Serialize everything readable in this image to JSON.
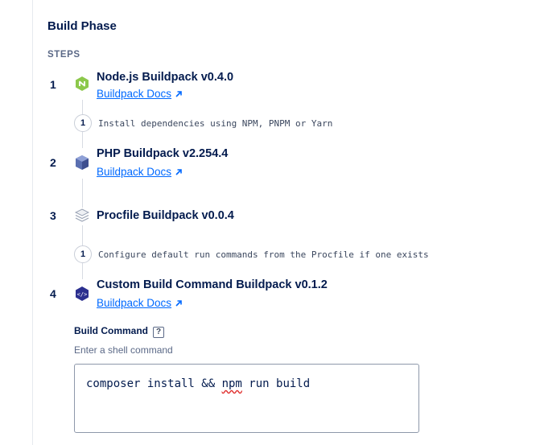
{
  "panel": {
    "title": "Build Phase",
    "steps_heading": "STEPS"
  },
  "steps": [
    {
      "number": "1",
      "title": "Node.js Buildpack v0.4.0",
      "icon": "nodejs-icon",
      "docs_link": "Buildpack Docs",
      "sub_steps": [
        {
          "number": "1",
          "text": "Install dependencies using NPM, PNPM or Yarn"
        }
      ]
    },
    {
      "number": "2",
      "title": "PHP Buildpack v2.254.4",
      "icon": "php-icon",
      "docs_link": "Buildpack Docs",
      "sub_steps": []
    },
    {
      "number": "3",
      "title": "Procfile Buildpack v0.0.4",
      "icon": "procfile-icon",
      "sub_steps": [
        {
          "number": "1",
          "text": "Configure default run commands from the Procfile if one exists"
        }
      ]
    },
    {
      "number": "4",
      "title": "Custom Build Command Buildpack v0.1.2",
      "icon": "custom-command-icon",
      "docs_link": "Buildpack Docs",
      "sub_steps": []
    }
  ],
  "build_command": {
    "label": "Build Command",
    "help": "?",
    "hint": "Enter a shell command",
    "value_before": "composer install && ",
    "value_flagged": "npm",
    "value_after": " run build"
  },
  "colors": {
    "text": "#031b4e",
    "link": "#0069ff",
    "muted": "#5b6987",
    "nodejs": "#8cc84b",
    "php": "#5a6fb0",
    "custom": "#2b2f8f"
  }
}
